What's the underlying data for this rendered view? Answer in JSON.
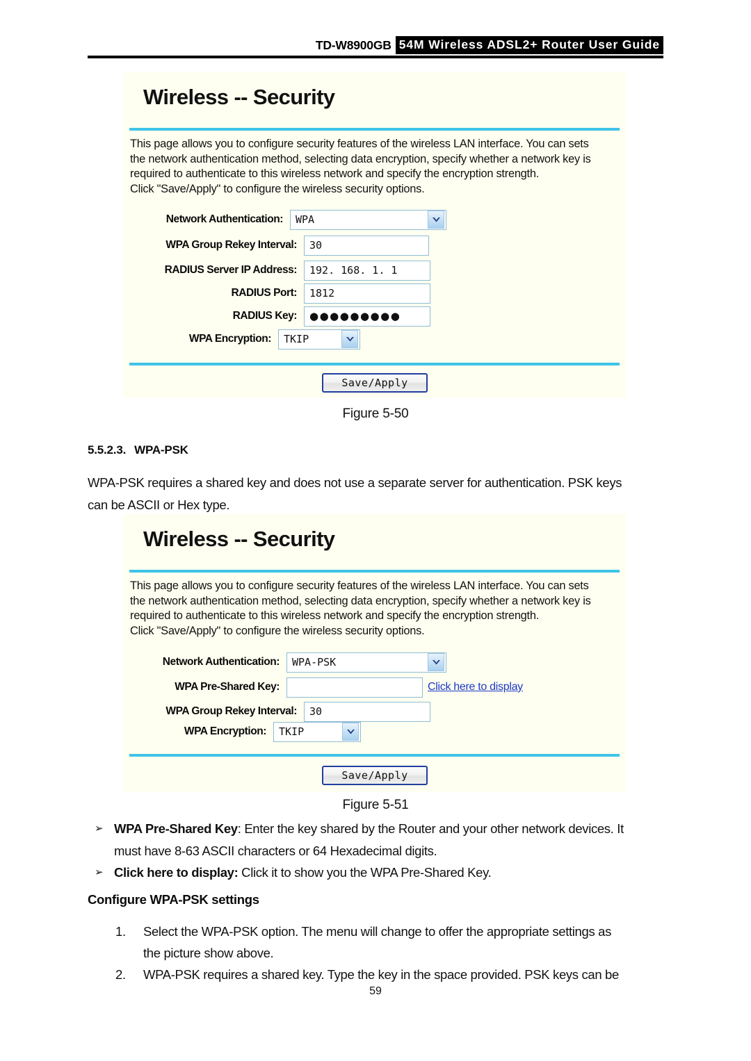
{
  "header": {
    "model": "TD-W8900GB",
    "title": "54M  Wireless  ADSL2+  Router  User  Guide"
  },
  "panel_wpa": {
    "title": "Wireless -- Security",
    "description": [
      "This page allows you to configure security features of the wireless LAN interface. You can sets",
      "the network authentication method, selecting data encryption, specify whether a network key is",
      "required to authenticate to this wireless network and specify the encryption strength.",
      "Click \"Save/Apply\" to configure the wireless security options."
    ],
    "fields": {
      "network_auth_label": "Network Authentication:",
      "network_auth_value": "WPA",
      "rekey_label": "WPA Group Rekey Interval:",
      "rekey_value": "30",
      "radius_ip_label": "RADIUS Server IP Address:",
      "radius_ip_value": "192. 168. 1. 1",
      "radius_port_label": "RADIUS Port:",
      "radius_port_value": "1812",
      "radius_key_label": "RADIUS Key:",
      "radius_key_value": "●●●●●●●●●",
      "encryption_label": "WPA Encryption:",
      "encryption_value": "TKIP"
    },
    "save_label": "Save/Apply"
  },
  "figure_50_caption": "Figure 5-50",
  "section": {
    "number": "5.5.2.3.",
    "title": "WPA-PSK"
  },
  "intro_paragraph": [
    "WPA-PSK requires a shared key and does not use a separate server for authentication. PSK keys",
    "can be ASCII or Hex type."
  ],
  "panel_wpapsk": {
    "title": "Wireless -- Security",
    "description": [
      "This page allows you to configure security features of the wireless LAN interface. You can sets",
      "the network authentication method, selecting data encryption, specify whether a network key is",
      "required to authenticate to this wireless network and specify the encryption strength.",
      "Click \"Save/Apply\" to configure the wireless security options."
    ],
    "fields": {
      "network_auth_label": "Network Authentication:",
      "network_auth_value": "WPA-PSK",
      "preshared_key_label": "WPA Pre-Shared Key:",
      "preshared_key_value": "",
      "display_link": "Click here to display",
      "rekey_label": "WPA Group Rekey Interval:",
      "rekey_value": "30",
      "encryption_label": "WPA Encryption:",
      "encryption_value": "TKIP"
    },
    "save_label": "Save/Apply"
  },
  "figure_51_caption": "Figure 5-51",
  "bullets": [
    {
      "marker": "➢",
      "bold": "WPA Pre-Shared Key",
      "line1_rest": ": Enter the key shared by the Router and your other network devices. It",
      "line2": "must have 8-63 ASCII characters or 64 Hexadecimal digits."
    },
    {
      "marker": "➢",
      "bold": "Click here to display:",
      "line1_rest": " Click it to show you the WPA Pre-Shared Key.",
      "line2": ""
    }
  ],
  "configure_subhead": "Configure WPA-PSK settings",
  "numbered_items": [
    {
      "marker": "1.",
      "line1": "Select the WPA-PSK option. The menu will change to offer the appropriate settings as",
      "line2": "the picture show above."
    },
    {
      "marker": "2.",
      "line1": "WPA-PSK requires a shared key. Type the key in the space provided. PSK keys can be",
      "line2": ""
    }
  ],
  "page_number": "59",
  "colors": {
    "panel_bg": "#fefff0",
    "rule_blue": "#3fc3e8",
    "link_blue": "#1b37c8",
    "input_border": "#8fbcd4",
    "button_border": "#1f3e9e"
  }
}
